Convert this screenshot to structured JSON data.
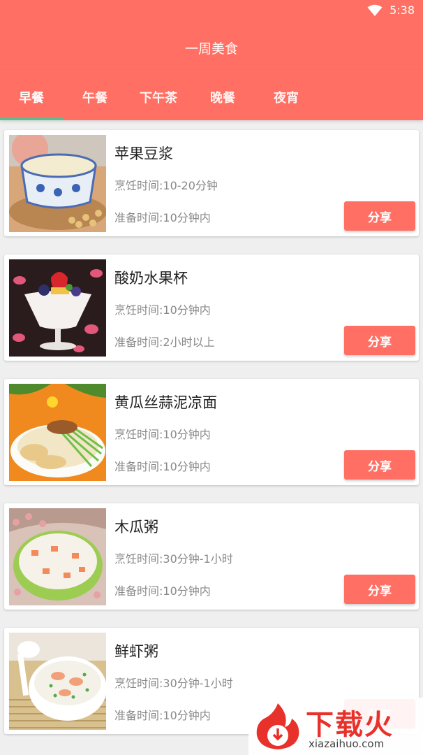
{
  "status": {
    "time": "5:38",
    "icon": "wifi-icon"
  },
  "app": {
    "title": "一周美食"
  },
  "tabs": [
    {
      "label": "早餐",
      "selected": true
    },
    {
      "label": "午餐",
      "selected": false
    },
    {
      "label": "下午茶",
      "selected": false
    },
    {
      "label": "晚餐",
      "selected": false
    },
    {
      "label": "夜宵",
      "selected": false
    }
  ],
  "recipes": [
    {
      "name": "苹果豆浆",
      "cook_time": "烹饪时间:10-20分钟",
      "prep_time": "准备时间:10分钟内",
      "share_label": "分享"
    },
    {
      "name": "酸奶水果杯",
      "cook_time": "烹饪时间:10分钟内",
      "prep_time": "准备时间:2小时以上",
      "share_label": "分享"
    },
    {
      "name": "黄瓜丝蒜泥凉面",
      "cook_time": "烹饪时间:10分钟内",
      "prep_time": "准备时间:10分钟内",
      "share_label": "分享"
    },
    {
      "name": "木瓜粥",
      "cook_time": "烹饪时间:30分钟-1小时",
      "prep_time": "准备时间:10分钟内",
      "share_label": "分享"
    },
    {
      "name": "鲜虾粥",
      "cook_time": "烹饪时间:30分钟-1小时",
      "prep_time": "准备时间:10分钟内",
      "share_label": "分享"
    }
  ],
  "watermark": {
    "text_cn": "下载火",
    "text_en": "xiazaihuo.com"
  },
  "colors": {
    "primary": "#ff6f63",
    "indicator": "#5bbf8d",
    "background": "#efefef"
  }
}
